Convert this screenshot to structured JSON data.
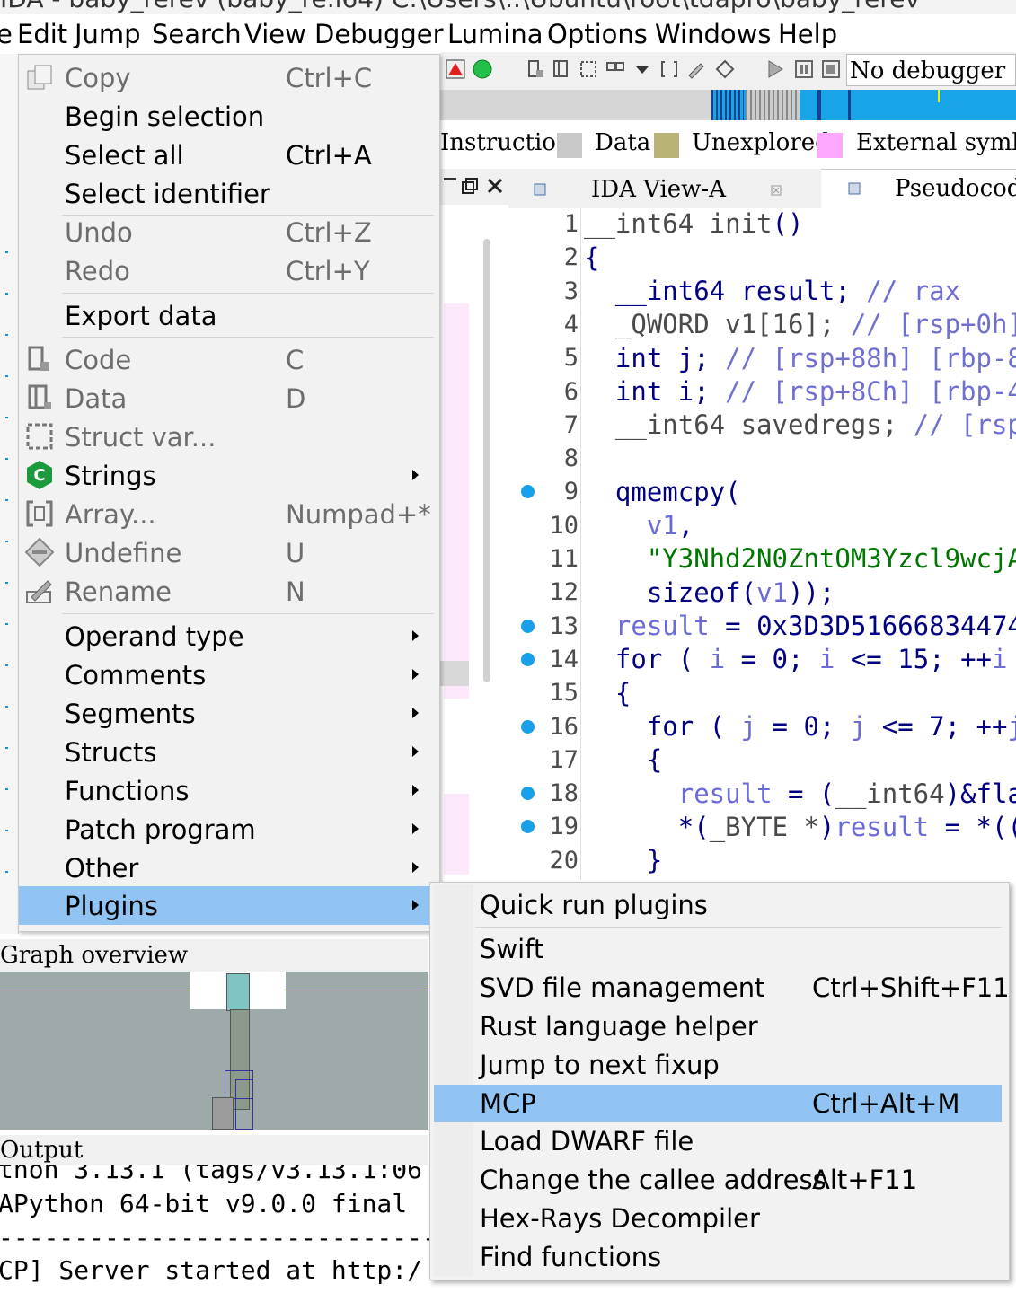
{
  "window": {
    "title_fragment": "IDA - baby_rerev (baby_re.i64) C:\\Users\\..\\Ubuntu\\root\\tdapro\\baby_rerev"
  },
  "menubar": {
    "items": [
      "e",
      "Edit",
      "Jump",
      "Search",
      "View",
      "Debugger",
      "Lumina",
      "Options",
      "Windows",
      "Help"
    ]
  },
  "toolbar": {
    "debugger_select": "No debugger"
  },
  "legend": {
    "items": [
      {
        "label": "Instruction",
        "color": ""
      },
      {
        "label": "Data",
        "color": "#c8c8c8"
      },
      {
        "label": "Unexplored",
        "color": "#b9b378"
      },
      {
        "label": "External symbol",
        "color": "#ffa8ff"
      }
    ]
  },
  "tabs": {
    "ida_view": "IDA View-A",
    "pseudocode": "Pseudocode-"
  },
  "code": {
    "line_numbers": [
      "1",
      "2",
      "3",
      "4",
      "5",
      "6",
      "7",
      "8",
      "9",
      "10",
      "11",
      "12",
      "13",
      "14",
      "15",
      "16",
      "17",
      "18",
      "19",
      "20"
    ],
    "breakpoint_lines": [
      "9",
      "13",
      "14",
      "16",
      "18",
      "19"
    ]
  },
  "context_menu": {
    "items": [
      {
        "label": "Copy",
        "shortcut": "Ctrl+C",
        "disabled": true
      },
      {
        "label": "Begin selection",
        "shortcut": ""
      },
      {
        "label": "Select all",
        "shortcut": "Ctrl+A"
      },
      {
        "label": "Select identifier",
        "shortcut": ""
      },
      {
        "label": "Undo",
        "shortcut": "Ctrl+Z",
        "disabled": true
      },
      {
        "label": "Redo",
        "shortcut": "Ctrl+Y",
        "disabled": true
      },
      {
        "label": "Export data",
        "shortcut": ""
      },
      {
        "label": "Code",
        "shortcut": "C",
        "disabled": true
      },
      {
        "label": "Data",
        "shortcut": "D",
        "disabled": true
      },
      {
        "label": "Struct var...",
        "shortcut": "",
        "disabled": true
      },
      {
        "label": "Strings",
        "shortcut": ""
      },
      {
        "label": "Array...",
        "shortcut": "Numpad+*",
        "disabled": true
      },
      {
        "label": "Undefine",
        "shortcut": "U",
        "disabled": true
      },
      {
        "label": "Rename",
        "shortcut": "N",
        "disabled": true
      },
      {
        "label": "Operand type",
        "shortcut": ""
      },
      {
        "label": "Comments",
        "shortcut": ""
      },
      {
        "label": "Segments",
        "shortcut": ""
      },
      {
        "label": "Structs",
        "shortcut": ""
      },
      {
        "label": "Functions",
        "shortcut": ""
      },
      {
        "label": "Patch program",
        "shortcut": ""
      },
      {
        "label": "Other",
        "shortcut": ""
      },
      {
        "label": "Plugins",
        "shortcut": ""
      }
    ]
  },
  "plugins_submenu": {
    "items": [
      {
        "label": "Quick run plugins",
        "shortcut": ""
      },
      {
        "label": "Swift",
        "shortcut": ""
      },
      {
        "label": "SVD file management",
        "shortcut": "Ctrl+Shift+F11"
      },
      {
        "label": "Rust language helper",
        "shortcut": ""
      },
      {
        "label": "Jump to next fixup",
        "shortcut": ""
      },
      {
        "label": "MCP",
        "shortcut": "Ctrl+Alt+M"
      },
      {
        "label": "Load DWARF file",
        "shortcut": ""
      },
      {
        "label": "Change the callee address",
        "shortcut": "Alt+F11"
      },
      {
        "label": "Hex-Rays Decompiler",
        "shortcut": ""
      },
      {
        "label": "Find functions",
        "shortcut": ""
      }
    ]
  },
  "panels": {
    "graph_overview": "Graph overview",
    "output": "Output",
    "output_lines": [
      "thon 3.13.1 (tags/v3.13.1:06",
      "APython 64-bit v9.0.0 final",
      "-------------------------------",
      "CP] Server started at http:/"
    ]
  }
}
